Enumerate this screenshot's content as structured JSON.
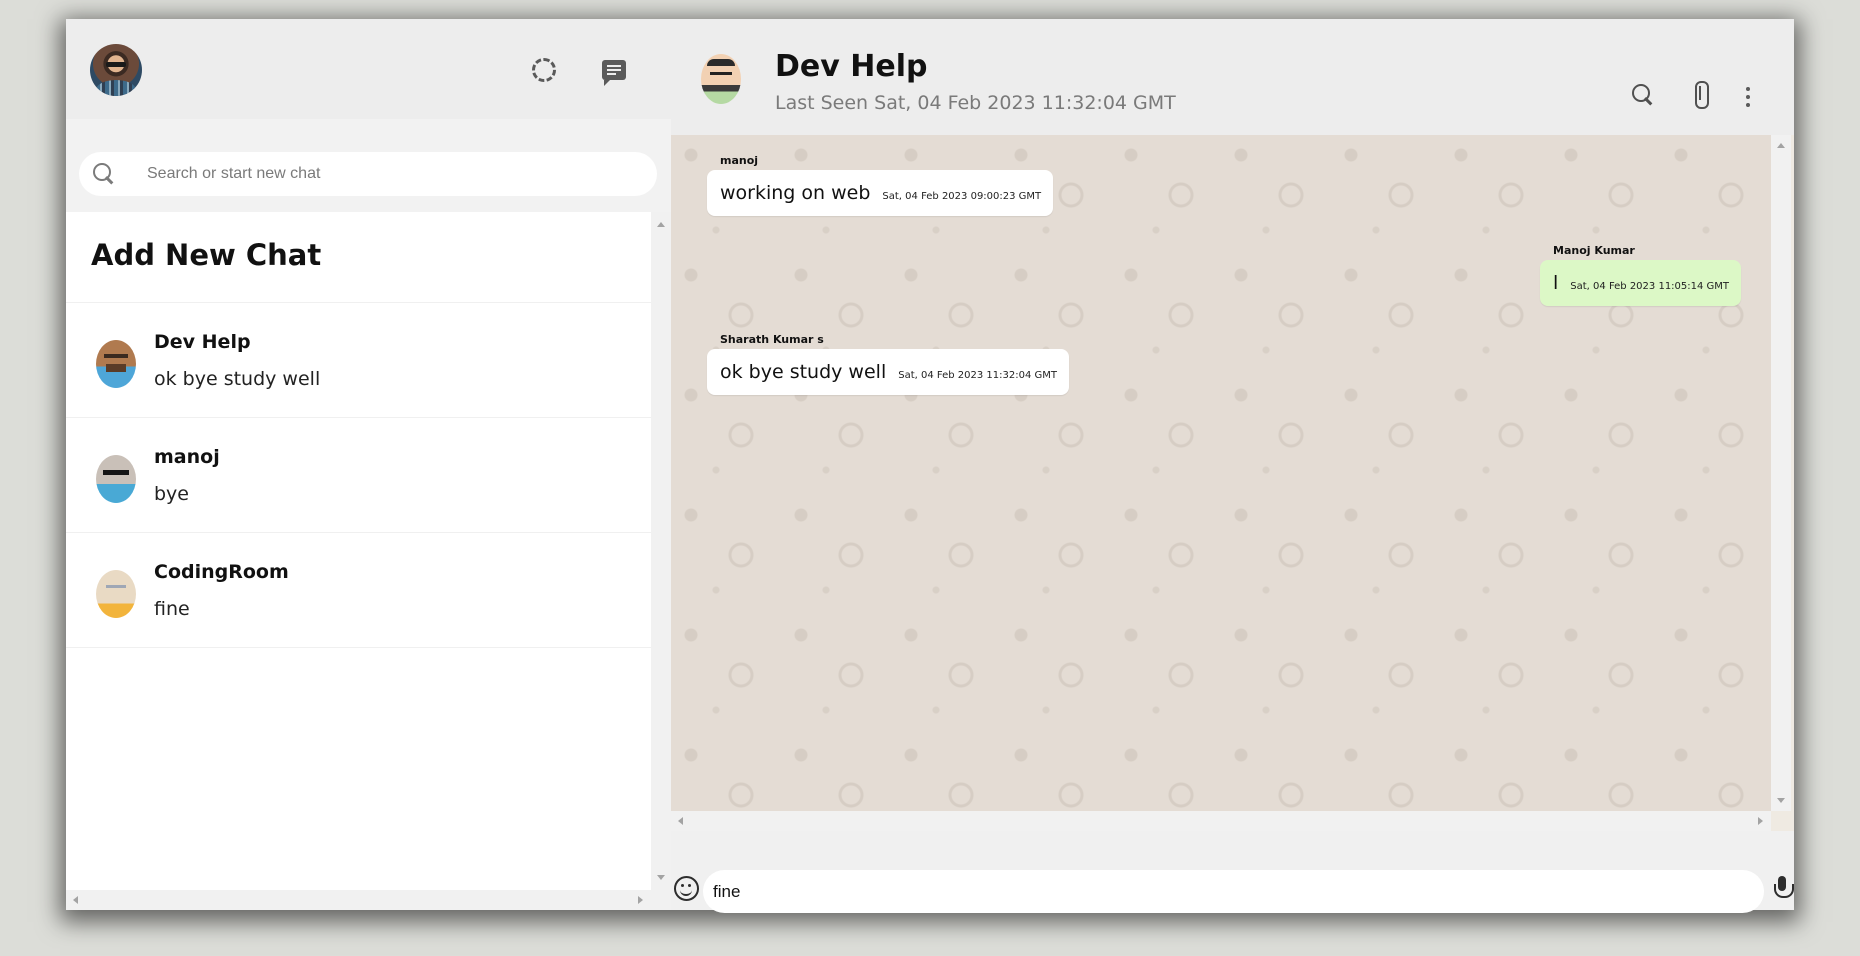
{
  "sidebar": {
    "search_placeholder": "Search or start new chat",
    "add_new_chat": "Add New Chat",
    "chats": [
      {
        "name": "Dev Help",
        "last_message": "ok bye study well"
      },
      {
        "name": "manoj",
        "last_message": "bye"
      },
      {
        "name": "CodingRoom",
        "last_message": "fine"
      }
    ]
  },
  "conversation": {
    "contact_name": "Dev Help",
    "last_seen": "Last Seen Sat, 04 Feb 2023 11:32:04 GMT",
    "messages": [
      {
        "sender": "manoj",
        "text": "working on web",
        "timestamp": "Sat, 04 Feb 2023 09:00:23 GMT",
        "direction": "in"
      },
      {
        "sender": "Manoj Kumar",
        "text": "l",
        "timestamp": "Sat, 04 Feb 2023 11:05:14 GMT",
        "direction": "out"
      },
      {
        "sender": "Sharath Kumar s",
        "text": "ok bye study well",
        "timestamp": "Sat, 04 Feb 2023 11:32:04 GMT",
        "direction": "in"
      }
    ],
    "input_value": "fine"
  },
  "colors": {
    "header_bg": "#ededed",
    "outgoing_bubble": "#dcf8c6",
    "incoming_bubble": "#ffffff",
    "chat_bg": "#e4dcd4"
  }
}
